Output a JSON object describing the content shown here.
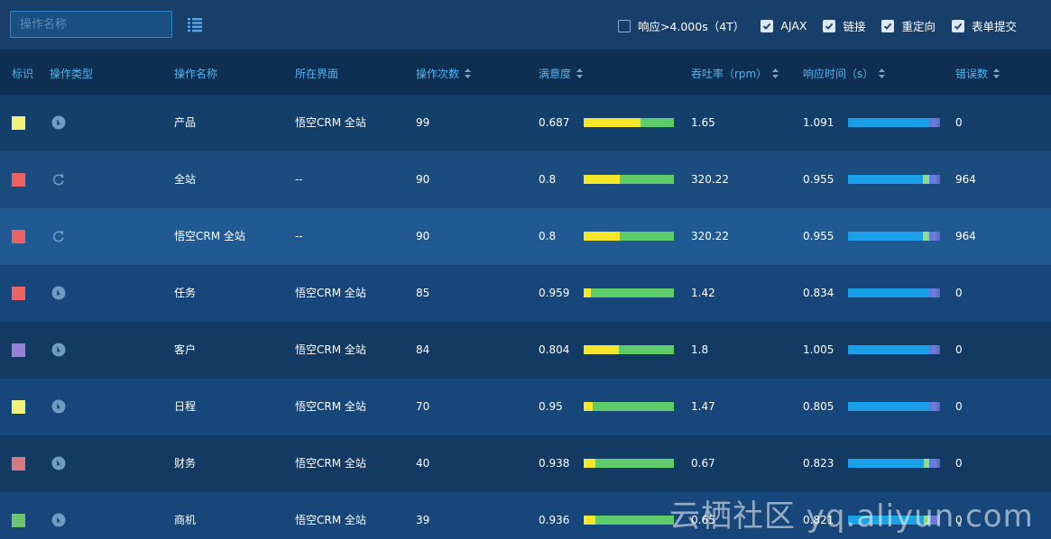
{
  "toolbar": {
    "search_placeholder": "操作名称",
    "filters": [
      {
        "label": "响应>4.000s（4T）",
        "checked": false
      },
      {
        "label": "AJAX",
        "checked": true
      },
      {
        "label": "链接",
        "checked": true
      },
      {
        "label": "重定向",
        "checked": true
      },
      {
        "label": "表单提交",
        "checked": true
      }
    ]
  },
  "columns": {
    "flag": "标识",
    "type": "操作类型",
    "name": "操作名称",
    "page": "所在界面",
    "count": "操作次数",
    "apdex": "满意度",
    "rpm": "吞吐率（rpm）",
    "resp": "响应时间（s）",
    "errors": "错误数"
  },
  "colors": {
    "apdex_yellow": "#f5e629",
    "apdex_green": "#5ecc6b",
    "resp_blue": "#1aa0e8",
    "resp_green": "#8fdc8a"
  },
  "rows": [
    {
      "color": "#f1f27a",
      "icon": "compass-icon",
      "name": "产品",
      "page": "悟空CRM 全站",
      "count": "99",
      "apdex": "0.687",
      "apdex_frac": 0.63,
      "rpm": "1.65",
      "resp": "1.091",
      "resp_frac": 1.0,
      "resp_green": 0,
      "errors": "0"
    },
    {
      "color": "#ee6262",
      "icon": "refresh-icon",
      "name": "全站",
      "page": "--",
      "count": "90",
      "apdex": "0.8",
      "apdex_frac": 0.4,
      "rpm": "320.22",
      "resp": "0.955",
      "resp_frac": 0.91,
      "resp_green": 0.07,
      "errors": "964"
    },
    {
      "color": "#ee6262",
      "icon": "refresh-icon",
      "name": "悟空CRM 全站",
      "page": "--",
      "count": "90",
      "apdex": "0.8",
      "apdex_frac": 0.4,
      "rpm": "320.22",
      "resp": "0.955",
      "resp_frac": 0.91,
      "resp_green": 0.07,
      "errors": "964"
    },
    {
      "color": "#ee6262",
      "icon": "compass-icon",
      "name": "任务",
      "page": "悟空CRM 全站",
      "count": "85",
      "apdex": "0.959",
      "apdex_frac": 0.08,
      "rpm": "1.42",
      "resp": "0.834",
      "resp_frac": 1.0,
      "resp_green": 0,
      "errors": "0"
    },
    {
      "color": "#9b7fd6",
      "icon": "compass-icon",
      "name": "客户",
      "page": "悟空CRM 全站",
      "count": "84",
      "apdex": "0.804",
      "apdex_frac": 0.39,
      "rpm": "1.8",
      "resp": "1.005",
      "resp_frac": 1.0,
      "resp_green": 0,
      "errors": "0"
    },
    {
      "color": "#f1f27a",
      "icon": "compass-icon",
      "name": "日程",
      "page": "悟空CRM 全站",
      "count": "70",
      "apdex": "0.95",
      "apdex_frac": 0.1,
      "rpm": "1.47",
      "resp": "0.805",
      "resp_frac": 1.0,
      "resp_green": 0,
      "errors": "0"
    },
    {
      "color": "#d47a80",
      "icon": "compass-icon",
      "name": "财务",
      "page": "悟空CRM 全站",
      "count": "40",
      "apdex": "0.938",
      "apdex_frac": 0.13,
      "rpm": "0.67",
      "resp": "0.823",
      "resp_frac": 0.96,
      "resp_green": 0.04,
      "errors": "0"
    },
    {
      "color": "#6fc26f",
      "icon": "compass-icon",
      "name": "商机",
      "page": "悟空CRM 全站",
      "count": "39",
      "apdex": "0.936",
      "apdex_frac": 0.13,
      "rpm": "0.65",
      "resp": "0.821",
      "resp_frac": 0.96,
      "resp_green": 0.04,
      "errors": "0"
    }
  ],
  "watermark": "云栖社区 yq.aliyun.com"
}
